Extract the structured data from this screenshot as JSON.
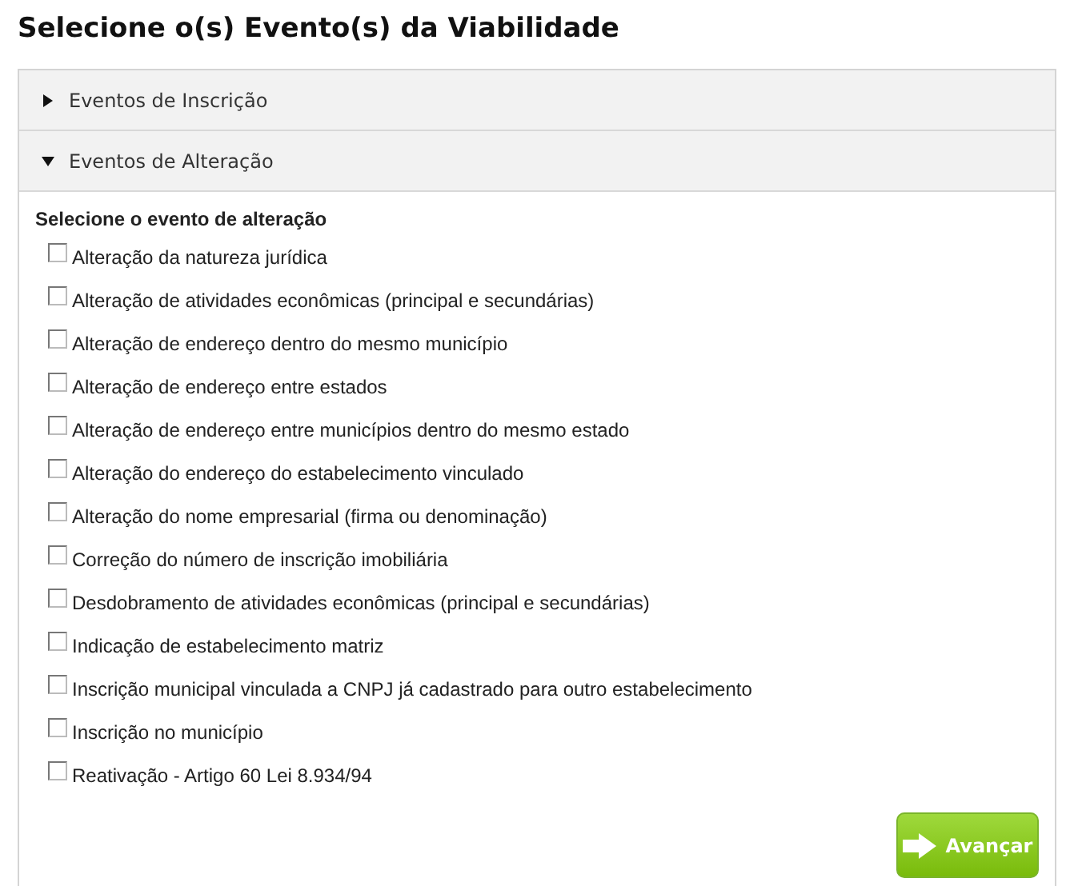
{
  "title": "Selecione o(s) Evento(s) da Viabilidade",
  "sections": [
    {
      "label": "Eventos de Inscrição",
      "expanded": false
    },
    {
      "label": "Eventos de Alteração",
      "expanded": true,
      "prompt": "Selecione o evento de alteração",
      "options": [
        {
          "label": "Alteração da natureza jurídica",
          "checked": false
        },
        {
          "label": "Alteração de atividades econômicas (principal e secundárias)",
          "checked": false
        },
        {
          "label": "Alteração de endereço dentro do mesmo município",
          "checked": false
        },
        {
          "label": "Alteração de endereço entre estados",
          "checked": false
        },
        {
          "label": "Alteração de endereço entre municípios dentro do mesmo estado",
          "checked": false
        },
        {
          "label": "Alteração do endereço do estabelecimento vinculado",
          "checked": false
        },
        {
          "label": "Alteração do nome empresarial (firma ou denominação)",
          "checked": false
        },
        {
          "label": "Correção do número de inscrição imobiliária",
          "checked": false
        },
        {
          "label": "Desdobramento de atividades econômicas (principal e secundárias)",
          "checked": false
        },
        {
          "label": "Indicação de estabelecimento matriz",
          "checked": false
        },
        {
          "label": "Inscrição municipal vinculada a CNPJ já cadastrado para outro estabelecimento",
          "checked": false
        },
        {
          "label": "Inscrição no município",
          "checked": false
        },
        {
          "label": "Reativação - Artigo 60 Lei 8.934/94",
          "checked": false
        }
      ]
    }
  ],
  "next_button": "Avançar"
}
